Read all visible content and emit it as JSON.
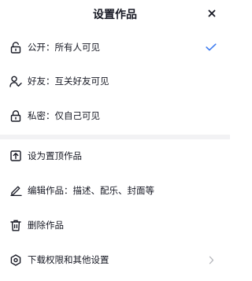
{
  "sheet": {
    "title": "设置作品",
    "close_icon": "close-icon"
  },
  "privacy": {
    "selected": "public",
    "options": [
      {
        "id": "public",
        "label": "公开：所有人可见",
        "icon": "lock-open-icon",
        "checked": true
      },
      {
        "id": "friends",
        "label": "好友：互关好友可见",
        "icon": "friends-icon",
        "checked": false
      },
      {
        "id": "private",
        "label": "私密：仅自己可见",
        "icon": "lock-icon",
        "checked": false
      }
    ]
  },
  "actions": [
    {
      "id": "pin",
      "label": "设为置顶作品",
      "icon": "pin-top-icon"
    },
    {
      "id": "edit",
      "label": "编辑作品：描述、配乐、封面等",
      "icon": "edit-pen-icon"
    },
    {
      "id": "delete",
      "label": "删除作品",
      "icon": "trash-icon"
    },
    {
      "id": "download",
      "label": "下载权限和其他设置",
      "icon": "settings-hexagon-icon",
      "chevron": "chevron-right-icon"
    }
  ],
  "colors": {
    "accent": "#3c7bf0",
    "text": "#161823",
    "divider": "#f2f2f4",
    "chevron": "#b7b8bd"
  }
}
